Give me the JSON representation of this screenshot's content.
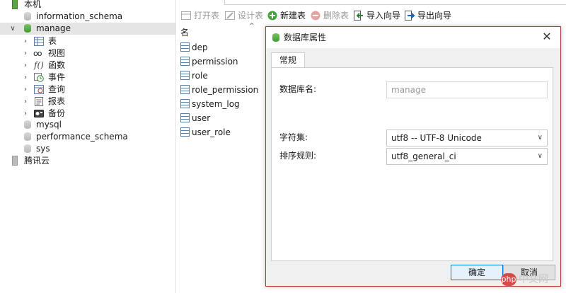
{
  "tree": {
    "root": "本机",
    "databases": [
      {
        "name": "information_schema"
      },
      {
        "name": "manage",
        "selected": true,
        "expanded": true,
        "children": [
          "表",
          "视图",
          "函数",
          "事件",
          "查询",
          "报表",
          "备份"
        ]
      },
      {
        "name": "mysql"
      },
      {
        "name": "performance_schema"
      },
      {
        "name": "sys"
      }
    ],
    "second_connection": "腾讯云"
  },
  "toolbar": {
    "open_table": "打开表",
    "design_table": "设计表",
    "new_table": "新建表",
    "delete_table": "删除表",
    "import_wizard": "导入向导",
    "export_wizard": "导出向导"
  },
  "list": {
    "column_header": "名",
    "tables": [
      "dep",
      "permission",
      "role",
      "role_permission",
      "system_log",
      "user",
      "user_role"
    ]
  },
  "dialog": {
    "title": "数据库属性",
    "tab": "常规",
    "db_name_label": "数据库名:",
    "db_name_value": "manage",
    "charset_label": "字符集:",
    "charset_value": "utf8 -- UTF-8 Unicode",
    "collation_label": "排序规则:",
    "collation_value": "utf8_general_ci",
    "ok": "确定",
    "cancel": "取消"
  },
  "watermark": {
    "logo": "php",
    "text": "中文网"
  },
  "colors": {
    "accent_border": "#b23a3a",
    "db_green": "#4ea83d",
    "primary_button_border": "#0078d7"
  }
}
